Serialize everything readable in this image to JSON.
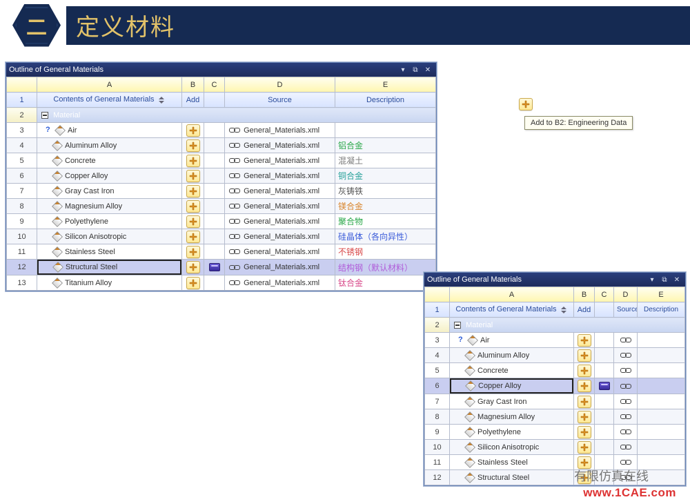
{
  "slide": {
    "hex_label": "二",
    "banner": "定义材料"
  },
  "panel1": {
    "title": "Outline of General Materials",
    "cols": [
      "A",
      "B",
      "C",
      "D",
      "E"
    ],
    "header": {
      "A": "Contents of General Materials",
      "B": "Add",
      "D": "Source",
      "E": "Description"
    },
    "group_label": "Material",
    "rows": [
      {
        "n": 3,
        "name": "Air",
        "q": true,
        "source": "General_Materials.xml",
        "desc": "",
        "color": ""
      },
      {
        "n": 4,
        "name": "Aluminum Alloy",
        "q": false,
        "source": "General_Materials.xml",
        "desc": "铝合金",
        "color": "c-green"
      },
      {
        "n": 5,
        "name": "Concrete",
        "q": false,
        "source": "General_Materials.xml",
        "desc": "混凝土",
        "color": "c-gray"
      },
      {
        "n": 6,
        "name": "Copper Alloy",
        "q": false,
        "source": "General_Materials.xml",
        "desc": "铜合金",
        "color": "c-teal"
      },
      {
        "n": 7,
        "name": "Gray Cast Iron",
        "q": false,
        "source": "General_Materials.xml",
        "desc": "灰铸铁",
        "color": "c-dark"
      },
      {
        "n": 8,
        "name": "Magnesium Alloy",
        "q": false,
        "source": "General_Materials.xml",
        "desc": "镁合金",
        "color": "c-orange"
      },
      {
        "n": 9,
        "name": "Polyethylene",
        "q": false,
        "source": "General_Materials.xml",
        "desc": "聚合物",
        "color": "c-green"
      },
      {
        "n": 10,
        "name": "Silicon Anisotropic",
        "q": false,
        "source": "General_Materials.xml",
        "desc": "硅晶体（各向异性）",
        "color": "c-blue"
      },
      {
        "n": 11,
        "name": "Stainless Steel",
        "q": false,
        "source": "General_Materials.xml",
        "desc": "不锈钢",
        "color": "c-red"
      },
      {
        "n": 12,
        "name": "Structural Steel",
        "q": false,
        "source": "General_Materials.xml",
        "desc": "结构钢（默认材料）",
        "color": "c-purple",
        "selected": true,
        "book": true
      },
      {
        "n": 13,
        "name": "Titanium Alloy",
        "q": false,
        "source": "General_Materials.xml",
        "desc": "钛合金",
        "color": "c-pink"
      }
    ]
  },
  "panel2": {
    "title": "Outline of General Materials",
    "cols": [
      "A",
      "B",
      "C",
      "D",
      "E"
    ],
    "header": {
      "A": "Contents of General Materials",
      "B": "Add",
      "D": "Source",
      "E": "Description"
    },
    "group_label": "Material",
    "rows": [
      {
        "n": 3,
        "name": "Air",
        "q": true
      },
      {
        "n": 4,
        "name": "Aluminum Alloy",
        "q": false
      },
      {
        "n": 5,
        "name": "Concrete",
        "q": false
      },
      {
        "n": 6,
        "name": "Copper Alloy",
        "q": false,
        "selected": true,
        "book": true
      },
      {
        "n": 7,
        "name": "Gray Cast Iron",
        "q": false
      },
      {
        "n": 8,
        "name": "Magnesium Alloy",
        "q": false
      },
      {
        "n": 9,
        "name": "Polyethylene",
        "q": false
      },
      {
        "n": 10,
        "name": "Silicon Anisotropic",
        "q": false
      },
      {
        "n": 11,
        "name": "Stainless Steel",
        "q": false
      },
      {
        "n": 12,
        "name": "Structural Steel",
        "q": false
      }
    ]
  },
  "tooltip": {
    "text": "Add to B2: Engineering Data"
  },
  "watermarks": {
    "wm1": "有限仿真在线",
    "wm2": "www.1CAE.com"
  }
}
